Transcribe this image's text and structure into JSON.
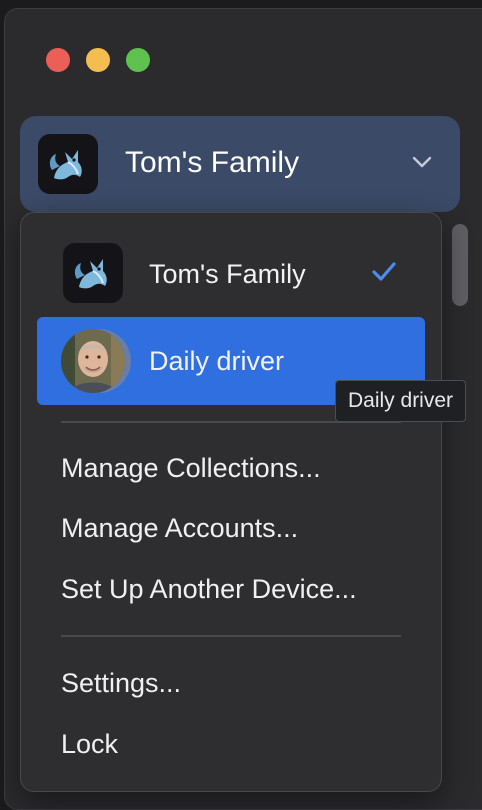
{
  "window": {
    "traffic_lights": [
      "close",
      "minimize",
      "zoom"
    ]
  },
  "account_switcher": {
    "name": "Tom's Family",
    "avatar_icon": "fox-icon",
    "chevron_icon": "chevron-down-icon"
  },
  "menu": {
    "accounts": [
      {
        "label": "Tom's Family",
        "selected": true,
        "avatar_icon": "fox-icon"
      },
      {
        "label": "Daily driver",
        "selected": false,
        "highlighted": true,
        "avatar": "photo"
      }
    ],
    "actions": [
      {
        "label": "Manage Collections..."
      },
      {
        "label": "Manage Accounts..."
      },
      {
        "label": "Set Up Another Device..."
      }
    ],
    "footer": [
      {
        "label": "Settings..."
      },
      {
        "label": "Lock"
      }
    ]
  },
  "tooltip": {
    "text": "Daily driver"
  },
  "colors": {
    "accent": "#2f6fe0",
    "checkmark": "#4a8cf0",
    "switcher_bg": "#3b4a67",
    "menu_bg": "#2e2e30"
  }
}
